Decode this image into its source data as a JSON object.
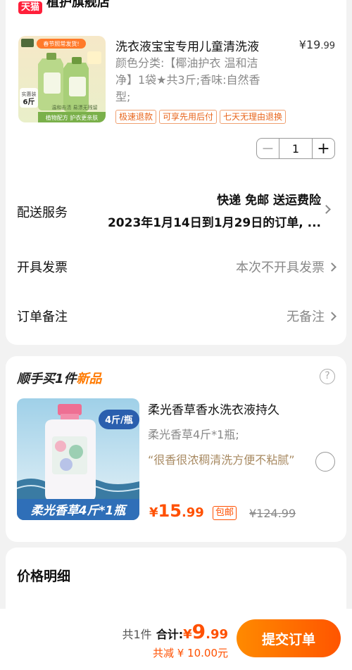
{
  "store": {
    "badge": "天猫",
    "name": "植护旗舰店"
  },
  "product": {
    "title": "洗衣液宝宝专用儿童清洗液",
    "price_symbol": "¥",
    "price_int": "19",
    "price_dec": ".99",
    "spec_lines": [
      "颜色分类:【椰油护衣 温和洁",
      "净】1袋★共3斤;香味:自然香",
      "型;"
    ],
    "tags": [
      "极速退款",
      "可享先用后付",
      "七天无理由退换"
    ],
    "thumb_text": {
      "top_banner": "春节照常发货!",
      "weight_label": "实惠装",
      "weight_value": "6斤",
      "slogan": "温和去渍 易漂无残留",
      "footer": "植物配方 护衣更亲肤"
    },
    "quantity": "1",
    "minus": "−",
    "plus": "+"
  },
  "delivery": {
    "label": "配送服务",
    "line1": "快递 免邮 送运费险",
    "line2": "2023年1月14日到1月29日的订单, ..."
  },
  "invoice": {
    "label": "开具发票",
    "value": "本次不开具发票"
  },
  "note": {
    "label": "订单备注",
    "value": "无备注"
  },
  "upsell": {
    "heading_a": "顺手买1件",
    "heading_b": "新品",
    "help": "?",
    "title": "柔光香草香水洗衣液持久",
    "spec": "柔光香草4斤*1瓶;",
    "review": "“很香很浓稠清洗方便不粘腻”",
    "price_symbol": "¥",
    "price_int": "15",
    "price_dec": ".99",
    "postage": "包邮",
    "orig_price": "¥124.99",
    "thumb_badge": "4斤/瓶",
    "thumb_caption": "柔光香草4斤*1瓶"
  },
  "price_detail": {
    "title": "价格明细"
  },
  "bottom": {
    "count": "共1件",
    "total_label": "合计:",
    "price_symbol": "¥",
    "price_int": "9",
    "price_dec": ".99",
    "discount": "共减 ¥ 10.00元",
    "submit": "提交订单"
  },
  "colors": {
    "accent": "#ff5000",
    "tmall_red": "#ff1f3a",
    "tag_orange": "#e8651c",
    "background": "#f2f2f2"
  }
}
